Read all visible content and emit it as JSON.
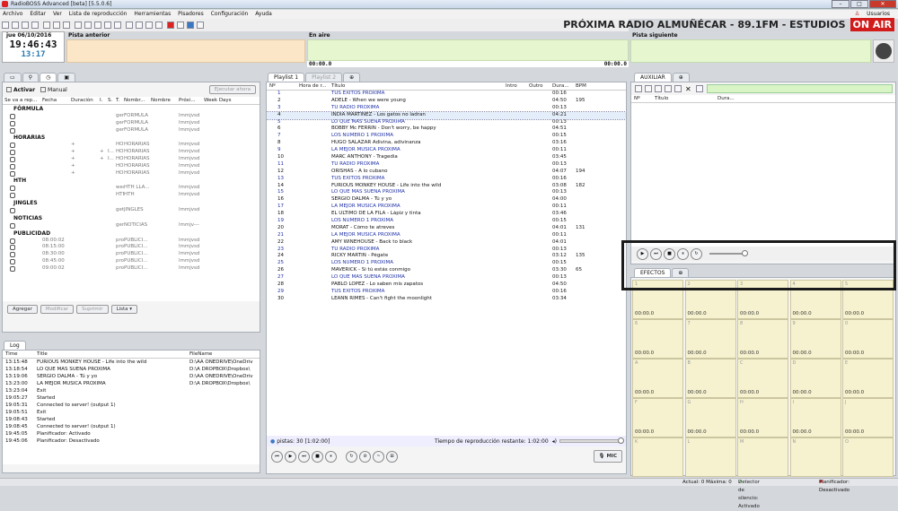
{
  "window": {
    "title": "RadioBOSS Advanced [beta] [5.5.0.6]"
  },
  "menu": [
    "Archivo",
    "Editar",
    "Ver",
    "Lista de reproducción",
    "Herramientas",
    "Pisadores",
    "Configuración",
    "Ayuda"
  ],
  "users_label": "Usuarios",
  "station": {
    "name": "PRÓXIMA RADIO ALMUÑÉCAR - 89.1FM - ESTUDIOS",
    "onair": "ON AIR"
  },
  "clock": {
    "date": "jue 06/10/2016",
    "time": "19:46:43",
    "countdown": "13:17"
  },
  "headers": {
    "prev": "Pista anterior",
    "onair": "En aire",
    "next": "Pista siguiente"
  },
  "air_times": {
    "left": "00:00.0",
    "right": "00:00.0"
  },
  "left_tabs": [
    "",
    "",
    "",
    ""
  ],
  "scheduler": {
    "activate_label": "Activar",
    "manual_label": "Manual",
    "run_now": "Ejecutar ahora",
    "columns": [
      "Se va a rep...",
      "Fecha",
      "Duración",
      "I.",
      "S.",
      "T.",
      "Nombr...",
      "Nombre",
      "Próxi...",
      "Week Days"
    ],
    "groups": [
      {
        "name": "FÓRMULA",
        "rows": [
          [
            "",
            "",
            "",
            "",
            "",
            "generate...",
            "FÓRMULA",
            "",
            "lmmjvsd"
          ],
          [
            "",
            "",
            "",
            "",
            "",
            "generate...",
            "FÓRMULA",
            "",
            "lmmjvsd"
          ],
          [
            "",
            "",
            "",
            "",
            "",
            "generate...",
            "FÓRMULA",
            "",
            "lmmjvsd"
          ]
        ]
      },
      {
        "name": "HORARIAS",
        "rows": [
          [
            "",
            "",
            "+",
            "",
            "",
            "HORARI...",
            "HORARIAS",
            "",
            "lmmjvsd"
          ],
          [
            "",
            "",
            "+",
            "+",
            "I...",
            "HORARI...",
            "HORARIAS",
            "",
            "lmmjvsd"
          ],
          [
            "",
            "",
            "+",
            "+",
            "I...",
            "HORARI...",
            "HORARIAS",
            "",
            "lmmjvsd"
          ],
          [
            "",
            "",
            "+",
            "",
            "",
            "HORARI...",
            "HORARIAS",
            "",
            "lmmjvsd"
          ],
          [
            "",
            "",
            "+",
            "",
            "",
            "HORARI...",
            "HORARIAS",
            "",
            "lmmjvsd"
          ]
        ]
      },
      {
        "name": "HTH",
        "rows": [
          [
            "",
            "",
            "",
            "",
            "",
            "weather ...",
            "HTH LLA...",
            "",
            "lmmjvsd"
          ],
          [
            "",
            "",
            "",
            "",
            "",
            "HTH GEN...",
            "HTH",
            "",
            "lmmjvsd"
          ]
        ]
      },
      {
        "name": "JINGLES",
        "rows": [
          [
            "",
            "",
            "",
            "",
            "",
            "getfile 'D...",
            "JINGLES",
            "",
            "lmmjvsd"
          ]
        ]
      },
      {
        "name": "NOTICIAS",
        "rows": [
          [
            "",
            "",
            "",
            "",
            "",
            "generate...",
            "NOTICIAS",
            "",
            "lmmjv---"
          ]
        ]
      },
      {
        "name": "PUBLICIDAD",
        "rows": [
          [
            "",
            "08:00:02",
            "",
            "",
            "",
            "proxima0...",
            "PUBLICI...",
            "",
            "lmmjvsd"
          ],
          [
            "",
            "08:15:00",
            "",
            "",
            "",
            "proxima0...",
            "PUBLICI...",
            "",
            "lmmjvsd"
          ],
          [
            "",
            "08:30:00",
            "",
            "",
            "",
            "proxima0...",
            "PUBLICI...",
            "",
            "lmmjvsd"
          ],
          [
            "",
            "08:45:00",
            "",
            "",
            "",
            "proxima0...",
            "PUBLICI...",
            "",
            "lmmjvsd"
          ],
          [
            "",
            "09:00:02",
            "",
            "",
            "",
            "proxima0...",
            "PUBLICI...",
            "",
            "lmmjvsd"
          ]
        ]
      }
    ],
    "buttons": [
      "Agregar",
      "Modificar",
      "Suprimir",
      "Lista"
    ]
  },
  "log": {
    "tab": "Log",
    "columns": [
      "Time",
      "Title",
      "FileName"
    ],
    "rows": [
      [
        "13:15:48",
        "FURIOUS MONKEY HOUSE - Life into the wild",
        "D:\\AA ONEDRIVE\\OneDriv"
      ],
      [
        "13:18:54",
        "LO QUE MAS SUENA PROXIMA",
        "D:\\A DROPBOX\\Dropbox\\"
      ],
      [
        "13:19:06",
        "SERGIO DALMA - Tú y yo",
        "D:\\AA ONEDRIVE\\OneDriv"
      ],
      [
        "13:23:00",
        "LA MEJOR MUSICA PROXIMA",
        "D:\\A DROPBOX\\Dropbox\\"
      ],
      [
        "13:23:04",
        "Exit",
        ""
      ],
      [
        "19:05:27",
        "Started",
        ""
      ],
      [
        "19:05:31",
        "Connected to server! (output 1)",
        ""
      ],
      [
        "19:05:51",
        "Exit",
        ""
      ],
      [
        "19:08:43",
        "Started",
        ""
      ],
      [
        "19:08:45",
        "Connected to server! (output 1)",
        ""
      ],
      [
        "19:45:05",
        "Planificador: Activado",
        ""
      ],
      [
        "19:45:06",
        "Planificador: Desactivado",
        ""
      ]
    ]
  },
  "playlist": {
    "tabs": [
      "Playlist 1",
      "Playlist 2"
    ],
    "columns": [
      "Nº",
      "Hora de r...",
      "Título",
      "Intro",
      "Outro",
      "Dura...",
      "BPM"
    ],
    "rows": [
      {
        "n": "1",
        "title": "TUS EXITOS PROXIMA",
        "dur": "00:16",
        "bpm": "",
        "blue": true
      },
      {
        "n": "2",
        "title": "ADELE - When we were young",
        "dur": "04:50",
        "bpm": "195",
        "blue": false
      },
      {
        "n": "3",
        "title": "TU RADIO PROXIMA",
        "dur": "00:13",
        "bpm": "",
        "blue": true
      },
      {
        "n": "4",
        "title": "INDIA MARTÍNEZ - Los gatos no ladran",
        "dur": "04:21",
        "bpm": "",
        "blue": false,
        "sel": true
      },
      {
        "n": "5",
        "title": "LO QUE MAS SUENA PROXIMA",
        "dur": "00:13",
        "bpm": "",
        "blue": true
      },
      {
        "n": "6",
        "title": "BOBBY Mc FERRIN - Don't worry, be happy",
        "dur": "04:51",
        "bpm": "",
        "blue": false
      },
      {
        "n": "7",
        "title": "LOS NUMERO 1 PROXIMA",
        "dur": "00:15",
        "bpm": "",
        "blue": true
      },
      {
        "n": "8",
        "title": "HUGO SALAZAR Adivina, adivinanza",
        "dur": "03:16",
        "bpm": "",
        "blue": false
      },
      {
        "n": "9",
        "title": "LA MEJOR MUSICA PROXIMA",
        "dur": "00:11",
        "bpm": "",
        "blue": true
      },
      {
        "n": "10",
        "title": "MARC ANTHONY - Tragedia",
        "dur": "03:45",
        "bpm": "",
        "blue": false
      },
      {
        "n": "11",
        "title": "TU RADIO PROXIMA",
        "dur": "00:13",
        "bpm": "",
        "blue": true
      },
      {
        "n": "12",
        "title": "ORISHAS - A lo cubano",
        "dur": "04:07",
        "bpm": "194",
        "blue": false
      },
      {
        "n": "13",
        "title": "TUS EXITOS PROXIMA",
        "dur": "00:16",
        "bpm": "",
        "blue": true
      },
      {
        "n": "14",
        "title": "FURIOUS MONKEY HOUSE - Life into the wild",
        "dur": "03:08",
        "bpm": "182",
        "blue": false
      },
      {
        "n": "15",
        "title": "LO QUE MAS SUENA PROXIMA",
        "dur": "00:13",
        "bpm": "",
        "blue": true
      },
      {
        "n": "16",
        "title": "SERGIO DALMA - Tú y yo",
        "dur": "04:00",
        "bpm": "",
        "blue": false
      },
      {
        "n": "17",
        "title": "LA MEJOR MUSICA PROXIMA",
        "dur": "00:11",
        "bpm": "",
        "blue": true
      },
      {
        "n": "18",
        "title": "EL ÚLTIMO DE LA FILA - Lápiz y tinta",
        "dur": "03:46",
        "bpm": "",
        "blue": false
      },
      {
        "n": "19",
        "title": "LOS NUMERO 1 PROXIMA",
        "dur": "00:15",
        "bpm": "",
        "blue": true
      },
      {
        "n": "20",
        "title": "MORAT - Cómo te atreves",
        "dur": "04:01",
        "bpm": "131",
        "blue": false
      },
      {
        "n": "21",
        "title": "LA MEJOR MUSICA PROXIMA",
        "dur": "00:11",
        "bpm": "",
        "blue": true
      },
      {
        "n": "22",
        "title": "AMY WINEHOUSE - Back to black",
        "dur": "04:01",
        "bpm": "",
        "blue": false
      },
      {
        "n": "23",
        "title": "TU RADIO PROXIMA",
        "dur": "00:13",
        "bpm": "",
        "blue": true
      },
      {
        "n": "24",
        "title": "RICKY MARTIN - Pégate",
        "dur": "03:12",
        "bpm": "135",
        "blue": false
      },
      {
        "n": "25",
        "title": "LOS NUMERO 1 PROXIMA",
        "dur": "00:15",
        "bpm": "",
        "blue": true
      },
      {
        "n": "26",
        "title": "MAVERICK - Si tú estás conmigo",
        "dur": "03:30",
        "bpm": "65",
        "blue": false
      },
      {
        "n": "27",
        "title": "LO QUE MAS SUENA PROXIMA",
        "dur": "00:13",
        "bpm": "",
        "blue": true
      },
      {
        "n": "28",
        "title": "PABLO LÓPEZ - Lo saben mis zapatos",
        "dur": "04:50",
        "bpm": "",
        "blue": false
      },
      {
        "n": "29",
        "title": "TUS EXITOS PROXIMA",
        "dur": "00:16",
        "bpm": "",
        "blue": true
      },
      {
        "n": "30",
        "title": "LEANN RIMES - Can't fight the moonlight",
        "dur": "03:34",
        "bpm": "",
        "blue": false
      }
    ],
    "summary": "pistas: 30 [1:02:00]",
    "remaining": "Tiempo de reproducción restante: 1:02:00",
    "mic": "MIC"
  },
  "aux": {
    "tab": "AUXILIAR",
    "columns": [
      "Nº",
      "Título",
      "Dura..."
    ]
  },
  "effects": {
    "tab": "EFECTOS",
    "pads": [
      [
        "1",
        "00:00.0"
      ],
      [
        "2",
        "00:00.0"
      ],
      [
        "3",
        "00:00.0"
      ],
      [
        "4",
        "00:00.0"
      ],
      [
        "5",
        "00:00.0"
      ],
      [
        "6",
        "00:00.0"
      ],
      [
        "7",
        "00:00.0"
      ],
      [
        "8",
        "00:00.0"
      ],
      [
        "9",
        "00:00.0"
      ],
      [
        "0",
        "00:00.0"
      ],
      [
        "A",
        "00:00.0"
      ],
      [
        "B",
        "00:00.0"
      ],
      [
        "C",
        "00:00.0"
      ],
      [
        "D",
        "00:00.0"
      ],
      [
        "E",
        "00:00.0"
      ],
      [
        "F",
        "00:00.0"
      ],
      [
        "G",
        "00:00.0"
      ],
      [
        "H",
        "00:00.0"
      ],
      [
        "I",
        "00:00.0"
      ],
      [
        "J",
        "00:00.0"
      ],
      [
        "K",
        ""
      ],
      [
        "L",
        ""
      ],
      [
        "M",
        ""
      ],
      [
        "N",
        ""
      ],
      [
        "O",
        ""
      ]
    ]
  },
  "statusbar": {
    "actual": "Actual: 0 Máxima: 0",
    "silence": "Detector de silencio: Activado",
    "planner": "Planificador: Desactivado"
  }
}
